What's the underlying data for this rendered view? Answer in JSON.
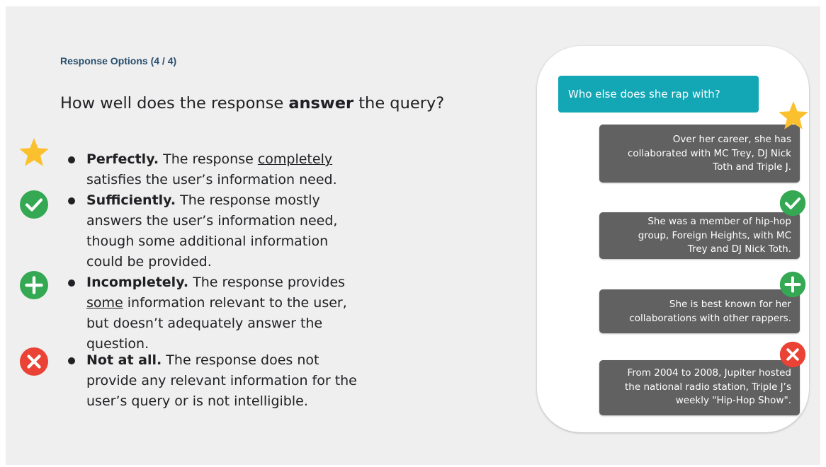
{
  "slide": {
    "section_label": "Response Options (4 / 4)",
    "question": {
      "prefix": "How well does the response ",
      "emphasis": "answer",
      "suffix": " the query?"
    }
  },
  "options": [
    {
      "icon": "star-icon",
      "color": "#fbc02d",
      "lines": [
        {
          "bold": "Perfectly.",
          "text": " The response ",
          "underline": "completely",
          "text2": ""
        },
        {
          "text": "satisfies the user’s information need."
        }
      ]
    },
    {
      "icon": "check-circle-icon",
      "color": "#34a853",
      "lines": [
        {
          "bold": "Sufficiently.",
          "text": " The response mostly"
        },
        {
          "text": "answers the user’s information need,"
        },
        {
          "text": "though some additional information"
        },
        {
          "text": "could be provided."
        }
      ]
    },
    {
      "icon": "plus-circle-icon",
      "color": "#34a853",
      "lines": [
        {
          "bold": "Incompletely.",
          "text": " The response provides"
        },
        {
          "underline": "some",
          "text": " information relevant to the user,"
        },
        {
          "text": "but doesn’t adequately answer the"
        },
        {
          "text": "question."
        }
      ]
    },
    {
      "icon": "x-circle-icon",
      "color": "#ea4335",
      "lines": [
        {
          "bold": "Not at all.",
          "text": " The response does not"
        },
        {
          "text": "provide any relevant information for the"
        },
        {
          "text": "user’s query or is not intelligible."
        }
      ]
    }
  ],
  "phone": {
    "query": "Who else does she rap with?",
    "query_color": "#13a7b6",
    "responses": [
      {
        "icon": "star-icon",
        "lines": [
          "Over her career, she has",
          "collaborated with MC Trey, DJ Nick",
          "Toth and Triple J."
        ]
      },
      {
        "icon": "check-circle-icon",
        "lines": [
          "She was a member of hip-hop",
          "group, Foreign Heights, with MC",
          "Trey and DJ Nick Toth."
        ]
      },
      {
        "icon": "plus-circle-icon",
        "lines": [
          "She is best known for her",
          "collaborations with other rappers."
        ]
      },
      {
        "icon": "x-circle-icon",
        "lines": [
          "From 2004 to 2008, Jupiter hosted",
          "the national radio station, Triple J’s",
          "weekly \"Hip-Hop Show\"."
        ]
      }
    ]
  }
}
